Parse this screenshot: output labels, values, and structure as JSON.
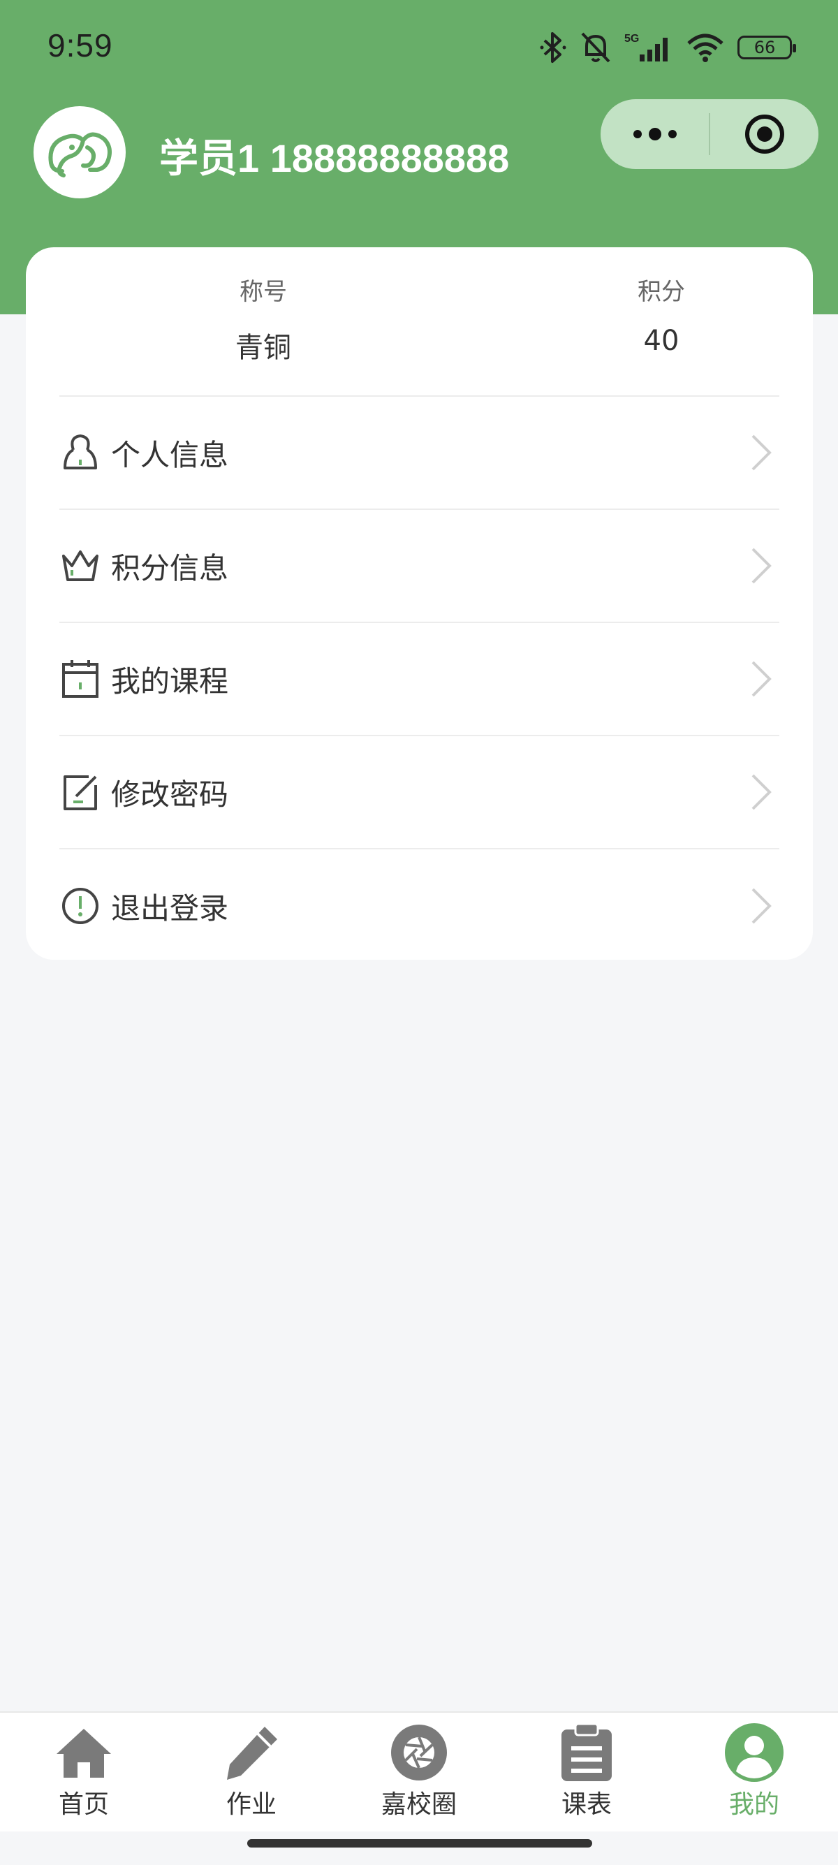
{
  "status_bar": {
    "time": "9:59",
    "battery": "66"
  },
  "header": {
    "user_title": "学员1 18888888888"
  },
  "stats": {
    "title_label": "称号",
    "title_value": "青铜",
    "points_label": "积分",
    "points_value": "40"
  },
  "menu": [
    {
      "label": "个人信息",
      "icon": "person-icon"
    },
    {
      "label": "积分信息",
      "icon": "crown-icon"
    },
    {
      "label": "我的课程",
      "icon": "calendar-icon"
    },
    {
      "label": "修改密码",
      "icon": "edit-icon"
    },
    {
      "label": "退出登录",
      "icon": "alert-circle-icon"
    }
  ],
  "tabs": [
    {
      "label": "首页",
      "icon": "home-icon"
    },
    {
      "label": "作业",
      "icon": "pencil-icon"
    },
    {
      "label": "嘉校圈",
      "icon": "aperture-icon"
    },
    {
      "label": "课表",
      "icon": "clipboard-icon"
    },
    {
      "label": "我的",
      "icon": "user-icon",
      "active": true
    }
  ],
  "colors": {
    "brand": "#68ae69",
    "capsule": "#c2e2c4",
    "background": "#f5f6f8"
  }
}
